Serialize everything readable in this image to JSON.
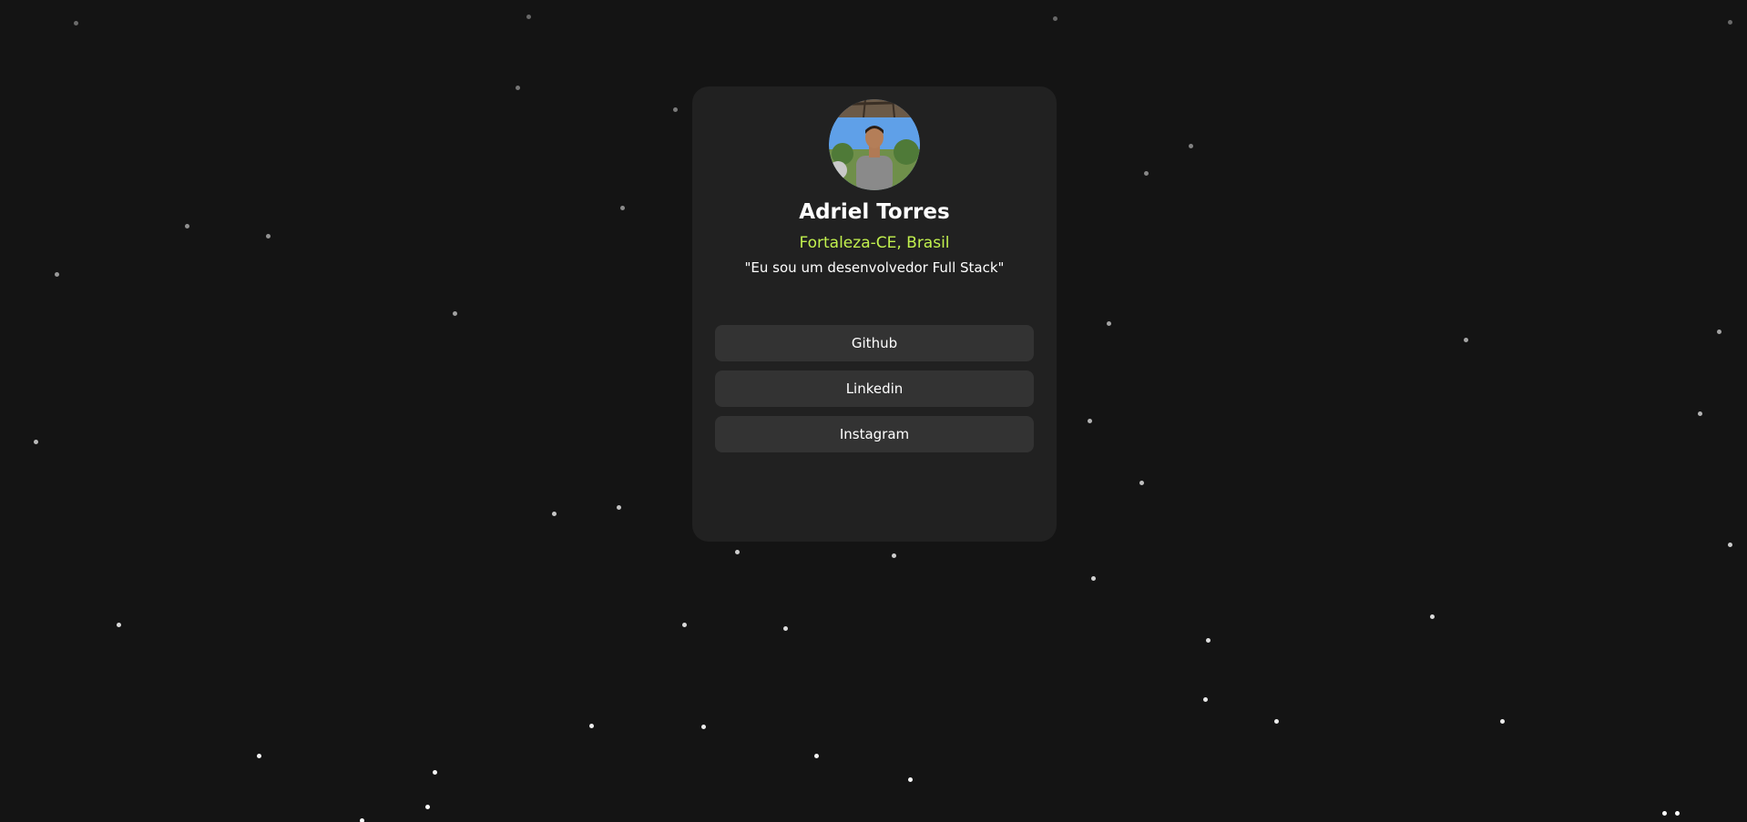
{
  "profile": {
    "name": "Adriel Torres",
    "location": "Fortaleza-CE, Brasil",
    "bio": "\"Eu sou um desenvolvedor Full Stack\""
  },
  "links": [
    {
      "label": "Github"
    },
    {
      "label": "Linkedin"
    },
    {
      "label": "Instagram"
    }
  ],
  "colors": {
    "background": "#141414",
    "card": "#212121",
    "button": "#333333",
    "accent": "#c2f14e",
    "text": "#ffffff"
  }
}
